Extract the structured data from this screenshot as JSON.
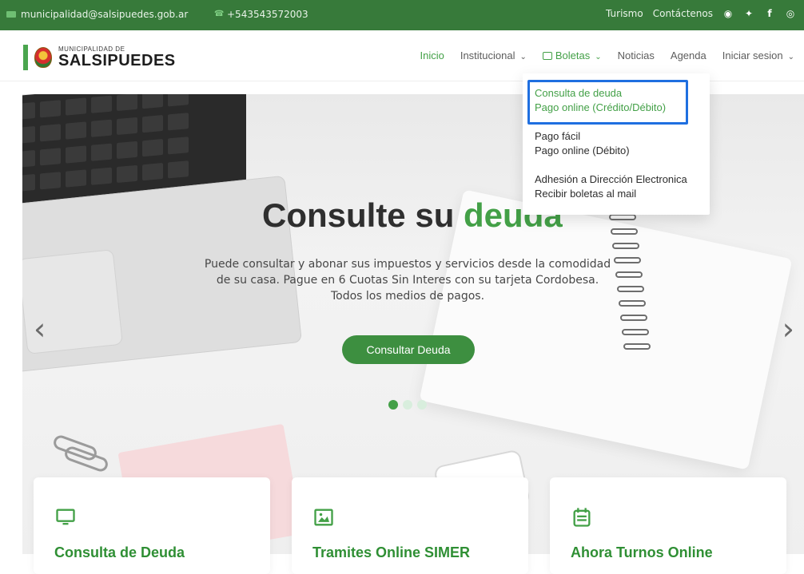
{
  "topbar": {
    "email": "municipalidad@salsipuedes.gob.ar",
    "phone": "+543543572003",
    "links": [
      "Turismo",
      "Contáctenos"
    ],
    "social": [
      "whatsapp-icon",
      "twitter-icon",
      "facebook-icon",
      "instagram-icon"
    ]
  },
  "nav": {
    "logo_small": "MUNICIPALIDAD DE",
    "logo_big": "SALSIPUEDES",
    "items": [
      {
        "label": "Inicio"
      },
      {
        "label": "Institucional"
      },
      {
        "label": "Boletas"
      },
      {
        "label": "Noticias"
      },
      {
        "label": "Agenda"
      },
      {
        "label": "Iniciar sesion"
      }
    ]
  },
  "dropdown": {
    "groups": [
      {
        "items": [
          "Consulta de deuda",
          "Pago online (Crédito/Débito)"
        ]
      },
      {
        "items": [
          "Pago fácil",
          "Pago online (Débito)"
        ]
      },
      {
        "items": [
          "Adhesión a Dirección Electronica",
          "Recibir boletas al mail"
        ]
      }
    ]
  },
  "hero": {
    "title_part1": "Consulte su ",
    "title_part2": "deuda",
    "subtitle": "Puede consultar y abonar sus impuestos y servicios desde la comodidad de su casa. Pague en 6 Cuotas Sin Interes con su tarjeta Cordobesa. Todos los medios de pagos.",
    "cta": "Consultar Deuda",
    "carousel_active": 1,
    "carousel_total": 3
  },
  "cards": [
    {
      "title": "Consulta de Deuda",
      "icon": "monitor-icon"
    },
    {
      "title": "Tramites Online SIMER",
      "icon": "image-icon"
    },
    {
      "title": "Ahora Turnos Online",
      "icon": "calendar-icon"
    }
  ],
  "colors": {
    "topbar": "#377a3a",
    "accent": "#43a047",
    "highlight": "#1f6fe0"
  }
}
